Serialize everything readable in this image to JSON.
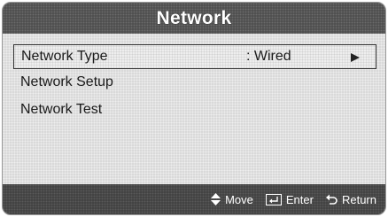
{
  "window": {
    "title": "Network"
  },
  "menu": {
    "items": [
      {
        "label": "Network Type",
        "value": ": Wired",
        "selected": true
      },
      {
        "label": "Network Setup"
      },
      {
        "label": "Network Test"
      }
    ]
  },
  "footer": {
    "move_label": "Move",
    "move_icon": "up-down-diamond-icon",
    "enter_label": "Enter",
    "enter_icon": "enter-icon",
    "return_label": "Return",
    "return_icon": "return-arrow-icon"
  },
  "colors": {
    "title_bg": "#4a4a4a",
    "content_bg": "#d9d9d9",
    "footer_bg": "#3e3e3e"
  }
}
